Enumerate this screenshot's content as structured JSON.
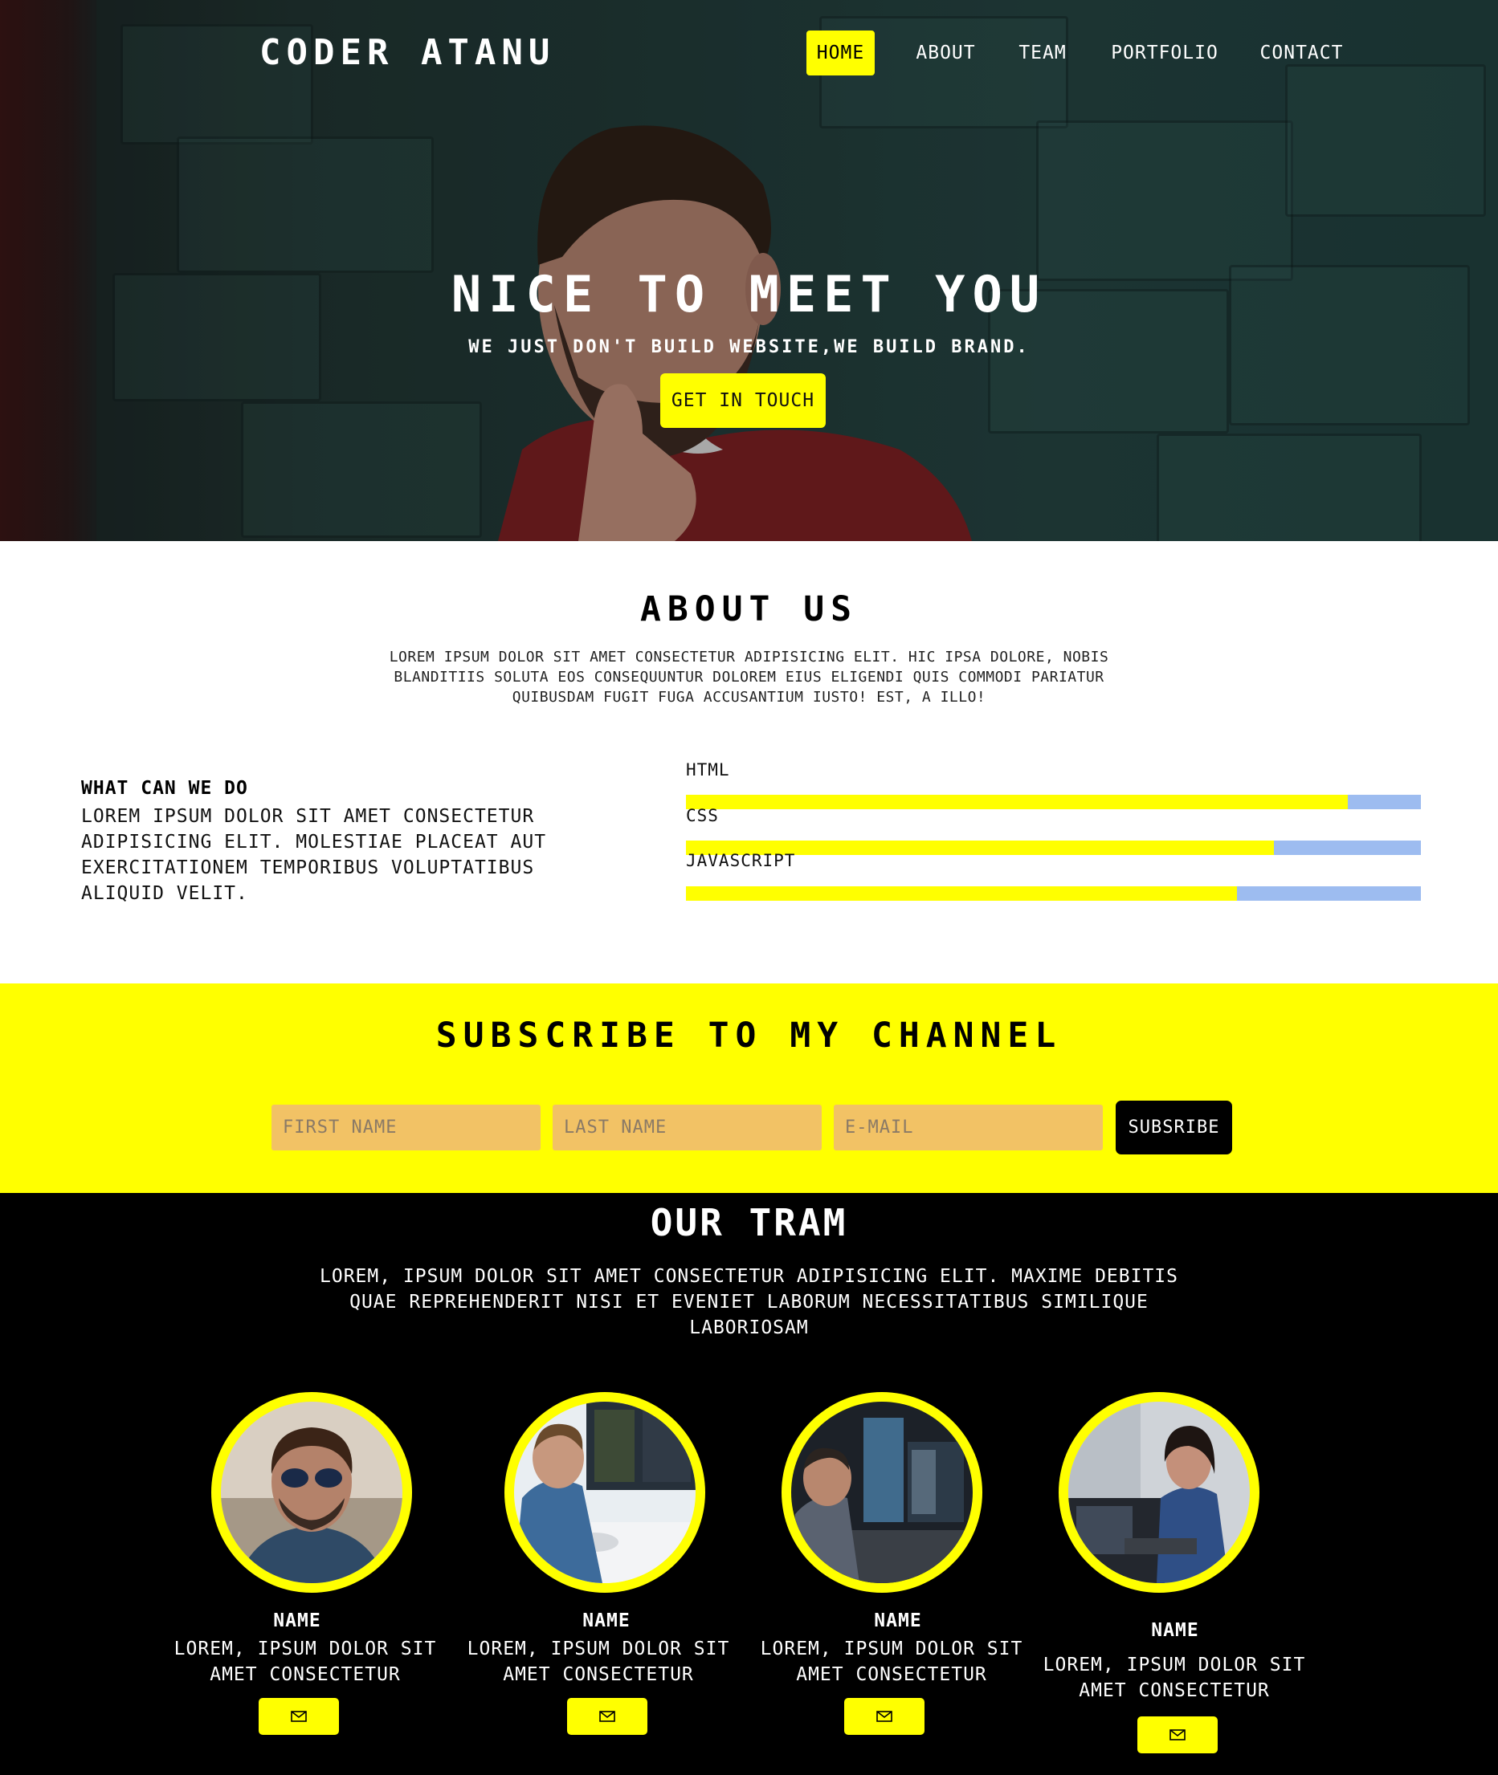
{
  "colors": {
    "accent": "#ffff00",
    "dark": "#000000",
    "white": "#ffffff",
    "skill_track": "#9dbcf0",
    "input_bg": "#f2c265"
  },
  "header": {
    "brand": "CODER ATANU",
    "nav": [
      {
        "label": "HOME",
        "active": true
      },
      {
        "label": "ABOUT",
        "active": false
      },
      {
        "label": "TEAM",
        "active": false
      },
      {
        "label": "PORTFOLIO",
        "active": false
      },
      {
        "label": "CONTACT",
        "active": false
      }
    ]
  },
  "hero": {
    "title": "NICE TO MEET YOU",
    "subtitle": "WE JUST DON'T BUILD WEBSITE,WE BUILD BRAND.",
    "cta_label": "GET IN TOUCH"
  },
  "about": {
    "title": "ABOUT US",
    "text": "LOREM IPSUM DOLOR SIT AMET CONSECTETUR ADIPISICING ELIT. HIC IPSA DOLORE, NOBIS BLANDITIIS SOLUTA EOS CONSEQUUNTUR DOLOREM EIUS ELIGENDI QUIS COMMODI PARIATUR QUIBUSDAM FUGIT FUGA ACCUSANTIUM IUSTO! EST, A ILLO!",
    "what_title": "WHAT CAN WE DO",
    "what_text": "LOREM IPSUM DOLOR SIT AMET CONSECTETUR ADIPISICING ELIT. MOLESTIAE PLACEAT AUT EXERCITATIONEM TEMPORIBUS VOLUPTATIBUS ALIQUID VELIT.",
    "skills": [
      {
        "label": "HTML",
        "level": 0.9
      },
      {
        "label": "CSS",
        "level": 0.8
      },
      {
        "label": "JAVASCRIPT",
        "level": 0.75
      }
    ]
  },
  "subscribe": {
    "title": "SUBSCRIBE TO MY CHANNEL",
    "first_name_placeholder": "FIRST NAME",
    "last_name_placeholder": "LAST NAME",
    "email_placeholder": "E-MAIL",
    "button_label": "SUBSRIBE"
  },
  "team": {
    "title": "OUR TRAM",
    "text": "LOREM, IPSUM DOLOR SIT AMET CONSECTETUR ADIPISICING ELIT. MAXIME DEBITIS QUAE REPREHENDERIT NISI ET EVENIET LABORUM NECESSITATIBUS SIMILIQUE LABORIOSAM",
    "members": [
      {
        "name": "NAME",
        "desc": "LOREM, IPSUM DOLOR SIT AMET CONSECTETUR",
        "icon": "mail-icon"
      },
      {
        "name": "NAME",
        "desc": "LOREM, IPSUM DOLOR SIT AMET CONSECTETUR",
        "icon": "mail-icon"
      },
      {
        "name": "NAME",
        "desc": "LOREM, IPSUM DOLOR SIT AMET CONSECTETUR",
        "icon": "mail-icon"
      },
      {
        "name": "NAME",
        "desc": "LOREM, IPSUM DOLOR SIT AMET CONSECTETUR",
        "icon": "mail-icon"
      }
    ]
  }
}
